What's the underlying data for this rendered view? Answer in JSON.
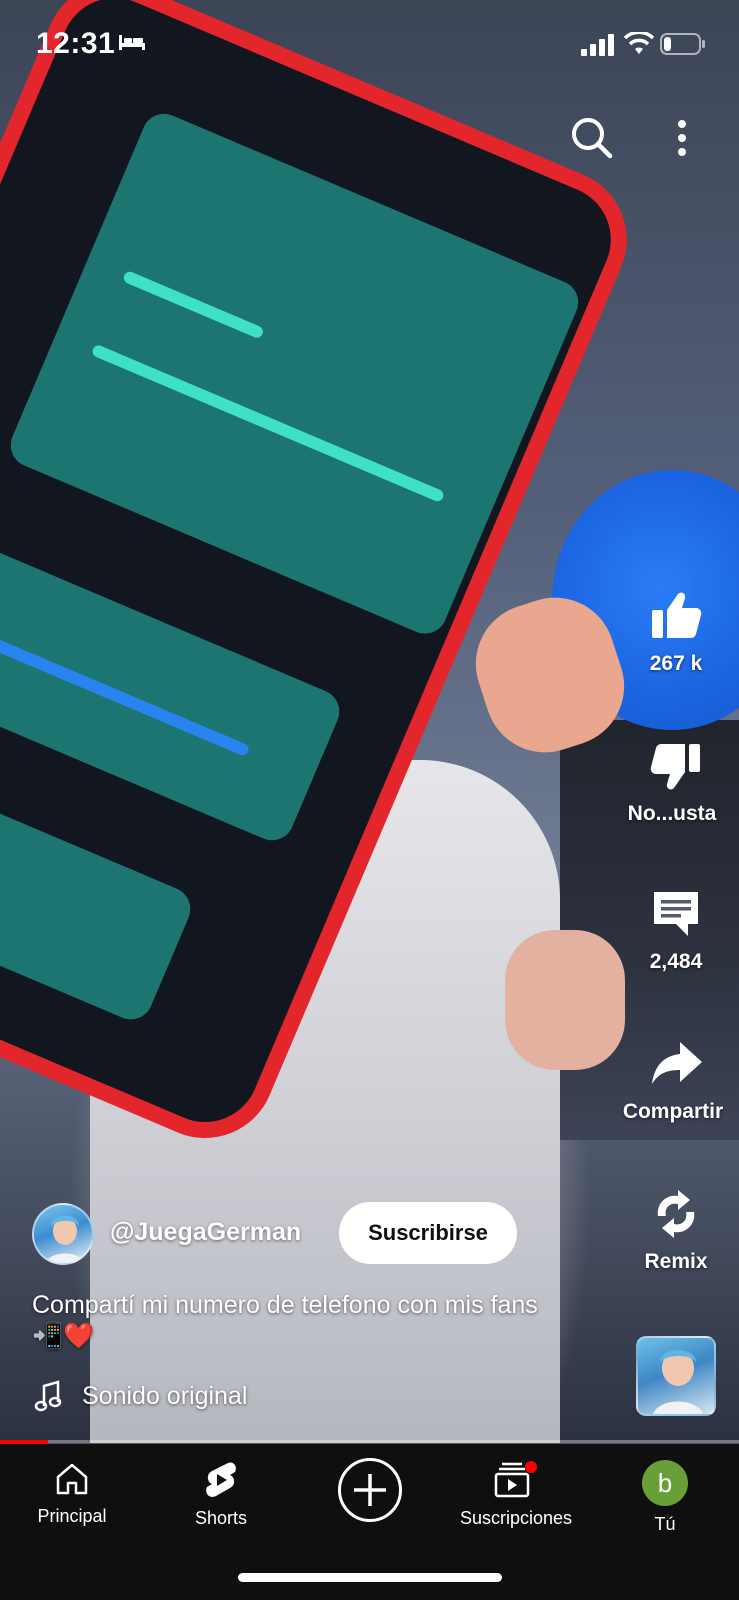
{
  "status_bar": {
    "time": "12:31",
    "icons": [
      "bed-icon",
      "signal-icon",
      "wifi-icon",
      "battery-icon"
    ]
  },
  "top_bar": {
    "icons": [
      "search-icon",
      "more-vertical-icon"
    ]
  },
  "actions": {
    "like": {
      "icon": "thumbs-up-icon",
      "label": "267 k"
    },
    "dislike": {
      "icon": "thumbs-down-icon",
      "label": "No...usta"
    },
    "comments": {
      "icon": "comment-icon",
      "label": "2,484"
    },
    "share": {
      "icon": "share-icon",
      "label": "Compartir"
    },
    "remix": {
      "icon": "remix-icon",
      "label": "Remix"
    }
  },
  "channel": {
    "handle": "@JuegaGerman",
    "subscribe_label": "Suscribirse"
  },
  "caption": "Compartí mi numero de telefono con mis fans 📲❤️",
  "sound": {
    "icon": "music-note-icon",
    "label": "Sonido original"
  },
  "progress": {
    "fraction": 0.065,
    "color": "#ff0000"
  },
  "bottom_nav": {
    "home": {
      "icon": "home-icon",
      "label": "Principal"
    },
    "shorts": {
      "icon": "shorts-icon",
      "label": "Shorts"
    },
    "create": {
      "icon": "plus-icon"
    },
    "subscriptions": {
      "icon": "subscriptions-icon",
      "label": "Suscripciones",
      "badge_color": "#ff0000"
    },
    "you": {
      "avatar_letter": "b",
      "avatar_color": "#689f38",
      "label": "Tú"
    }
  }
}
